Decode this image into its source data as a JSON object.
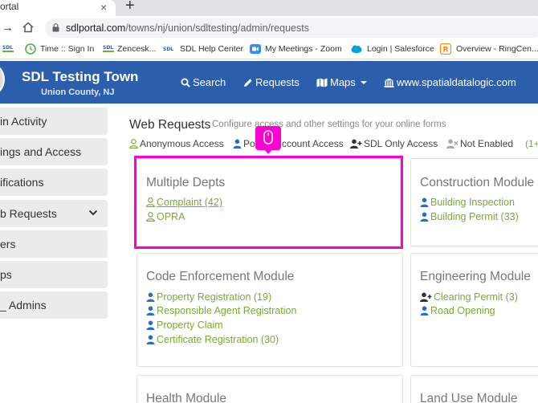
{
  "browser": {
    "tab_title": "ortal",
    "tab_close": "×",
    "new_tab": "+",
    "url_host": "sdlportal.com",
    "url_path": "/towns/nj/union/sdltesting/admin/requests"
  },
  "bookmarks": [
    {
      "label": "",
      "icon": "sdl-logo-icon"
    },
    {
      "label": "Time :: Sign In",
      "icon": "clock-icon"
    },
    {
      "label": "Zencesk...",
      "icon": "sdl-logo-icon"
    },
    {
      "label": "SDL Help Center",
      "icon": "sdl-logo-icon"
    },
    {
      "label": "My Meetings - Zoom",
      "icon": "zoom-icon"
    },
    {
      "label": "Login | Salesforce",
      "icon": "salesforce-cloud-icon"
    },
    {
      "label": "Overview - RingCen...",
      "icon": "ringcentral-icon"
    }
  ],
  "header": {
    "town_name": "SDL Testing Town",
    "county": "Union County, NJ",
    "nav": [
      {
        "label": "Search",
        "icon": "search-icon"
      },
      {
        "label": "Requests",
        "icon": "pencil-icon"
      },
      {
        "label": "Maps",
        "icon": "map-icon"
      },
      {
        "label": "www.spatialdatalogic.com",
        "icon": "building-icon"
      }
    ]
  },
  "sidebar": {
    "items": [
      {
        "label": "in Activity"
      },
      {
        "label": "ings and Access"
      },
      {
        "label": "ifications"
      },
      {
        "label": "b Requests",
        "expanded": true
      },
      {
        "label": "ers"
      },
      {
        "label": "ps"
      },
      {
        "label": "_ Admins"
      }
    ]
  },
  "main": {
    "title": "Web Requests",
    "subtitle": "Configure access and other settings for your online forms",
    "legend": [
      {
        "label": "Anonymous Access",
        "icon": "user-outline-icon"
      },
      {
        "label": "Por",
        "icon": "user-solid-icon"
      },
      {
        "label": "ccount Access",
        "icon": ""
      },
      {
        "label": "SDL Only Access",
        "icon": "user-plus-icon"
      },
      {
        "label": "Not Enabled",
        "icon": "user-x-icon"
      },
      {
        "label": "(1+",
        "icon": ""
      }
    ],
    "cards": [
      {
        "title": "Multiple Depts",
        "items": [
          {
            "label": "Complaint (42)",
            "icon": "user-outline-icon"
          },
          {
            "label": "OPRA",
            "icon": "user-outline-icon"
          }
        ]
      },
      {
        "title": "Construction Module",
        "items": [
          {
            "label": "Building Inspection",
            "icon": "user-solid-icon"
          },
          {
            "label": "Building Permit (33)",
            "icon": "user-solid-icon"
          }
        ]
      },
      {
        "title": "Code Enforcement Module",
        "items": [
          {
            "label": "Property Registration (19)",
            "icon": "user-solid-icon"
          },
          {
            "label": "Responsible Agent Registration",
            "icon": "user-solid-icon"
          },
          {
            "label": "Property Claim",
            "icon": "user-solid-icon"
          },
          {
            "label": "Certificate Registration (30)",
            "icon": "user-solid-icon"
          }
        ]
      },
      {
        "title": "Engineering Module",
        "items": [
          {
            "label": "Clearing Permit (3)",
            "icon": "user-plus-icon"
          },
          {
            "label": "Road Opening",
            "icon": "user-solid-icon"
          }
        ]
      },
      {
        "title": "Health Module",
        "items": []
      },
      {
        "title": "Land Use Module",
        "items": []
      }
    ]
  },
  "colors": {
    "header_blue": "#2b5fae",
    "link_green": "#7aa83a",
    "highlight_magenta": "#ff00d4",
    "anonymous_icon_green": "#7aa83a",
    "portal_icon_blue": "#2b6cc4"
  }
}
